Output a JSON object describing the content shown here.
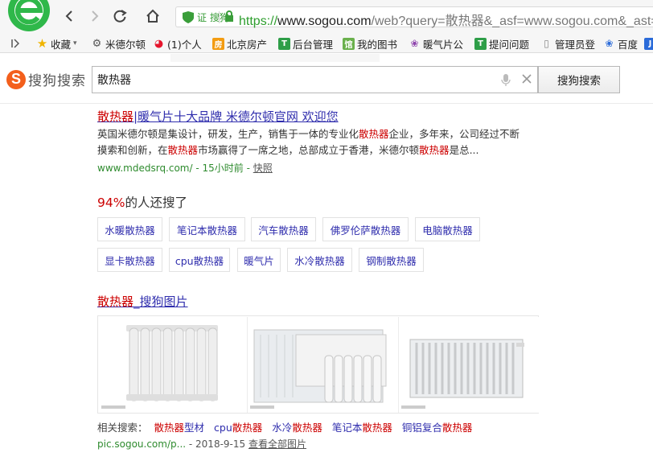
{
  "browser": {
    "cert_label": "证 搜狗",
    "url_scheme": "https://",
    "url_host": "www.sogou.com",
    "url_rest": "/web?query=散热器&_asf=www.sogou.com&_ast=&w"
  },
  "bookmarks": [
    {
      "label": "收藏",
      "icon": "star-icon"
    },
    {
      "label": "米德尔顿",
      "icon": "gear-icon"
    },
    {
      "label": "(1)个人",
      "icon": "weibo-icon"
    },
    {
      "label": "北京房产",
      "icon": "house-icon"
    },
    {
      "label": "后台管理",
      "icon": "t-icon"
    },
    {
      "label": "我的图书",
      "icon": "book-icon"
    },
    {
      "label": "暖气片公",
      "icon": "baidu-paw-icon"
    },
    {
      "label": "提问问题",
      "icon": "t-icon"
    },
    {
      "label": "管理员登",
      "icon": "page-icon"
    },
    {
      "label": "百度",
      "icon": "baidu-paw-icon"
    }
  ],
  "search": {
    "logo_text": "搜狗搜索",
    "query": "散热器",
    "button_label": "搜狗搜索"
  },
  "result1": {
    "title_hl": "散热器",
    "title_rest": "|暖气片十大品牌 米德尔顿官网 欢迎您",
    "desc_line1_a": "英国米德尔顿是集设计，研发，生产，销售于一体的专业化",
    "desc_line1_hl": "散热器",
    "desc_line1_b": "企业，多年来，公司经过不断",
    "desc_line2_a": "摸索和创新，在",
    "desc_line2_hl": "散热器",
    "desc_line2_b": "市场赢得了一席之地，总部成立于香港，米德尔顿",
    "desc_line2_hl2": "散热器",
    "desc_line2_c": "是总...",
    "url": "www.mdedsrq.com/",
    "time": " - 15小时前 - ",
    "snapshot": "快照"
  },
  "related": {
    "pct": "94%",
    "text": "的人还搜了",
    "row1": [
      "水暖散热器",
      "笔记本散热器",
      "汽车散热器",
      "佛罗伦萨散热器",
      "电脑散热器"
    ],
    "row2": [
      "显卡散热器",
      "cpu散热器",
      "暖气片",
      "水冷散热器",
      "钢制散热器"
    ]
  },
  "images_result": {
    "title_hl": "散热器",
    "title_rest": "_搜狗图片",
    "related_label": "相关搜索：",
    "related_links": [
      {
        "a": "",
        "hl": "散热器",
        "b": "型材"
      },
      {
        "a": "cpu",
        "hl": "散热器",
        "b": ""
      },
      {
        "a": "水冷",
        "hl": "散热器",
        "b": ""
      },
      {
        "a": "笔记本",
        "hl": "散热器",
        "b": ""
      },
      {
        "a": "铜铝复合",
        "hl": "散热器",
        "b": ""
      }
    ],
    "url": "pic.sogou.com/p...",
    "date": " - 2018-9-15 ",
    "view_all": "查看全部图片"
  }
}
